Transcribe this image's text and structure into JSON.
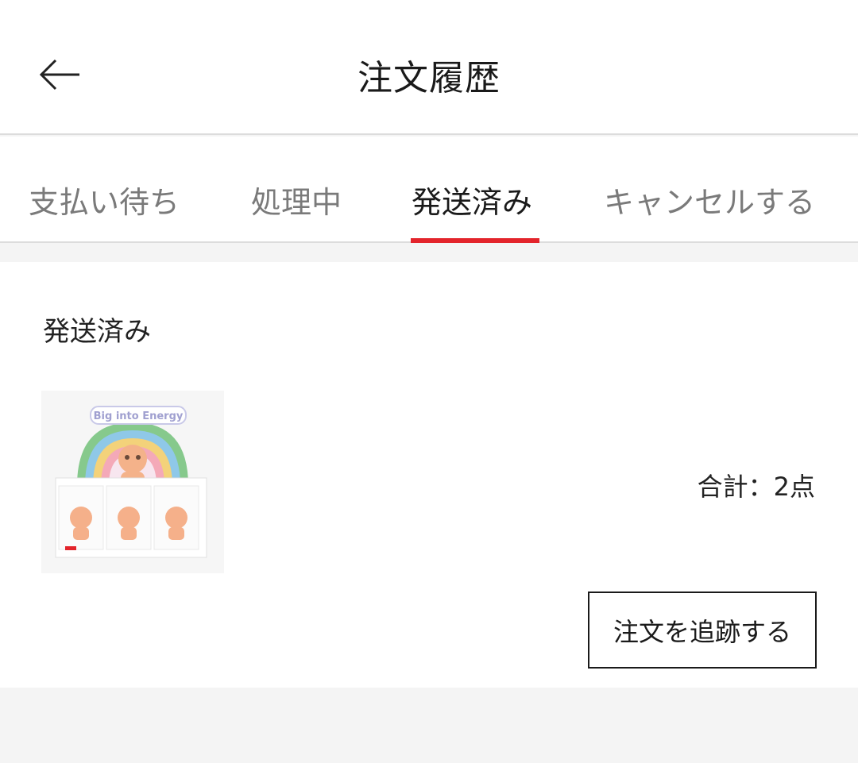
{
  "header": {
    "title": "注文履歴",
    "back_icon": "arrow-left-icon"
  },
  "tabs": [
    {
      "label": "支払い待ち",
      "active": false
    },
    {
      "label": "処理中",
      "active": false
    },
    {
      "label": "発送済み",
      "active": true
    },
    {
      "label": "キャンセルする",
      "active": false
    }
  ],
  "accent_color": "#e3242b",
  "order": {
    "status": "発送済み",
    "product_image_text": "Big into Energy",
    "total_label": "合計：2点",
    "track_button": "注文を追跡する"
  }
}
